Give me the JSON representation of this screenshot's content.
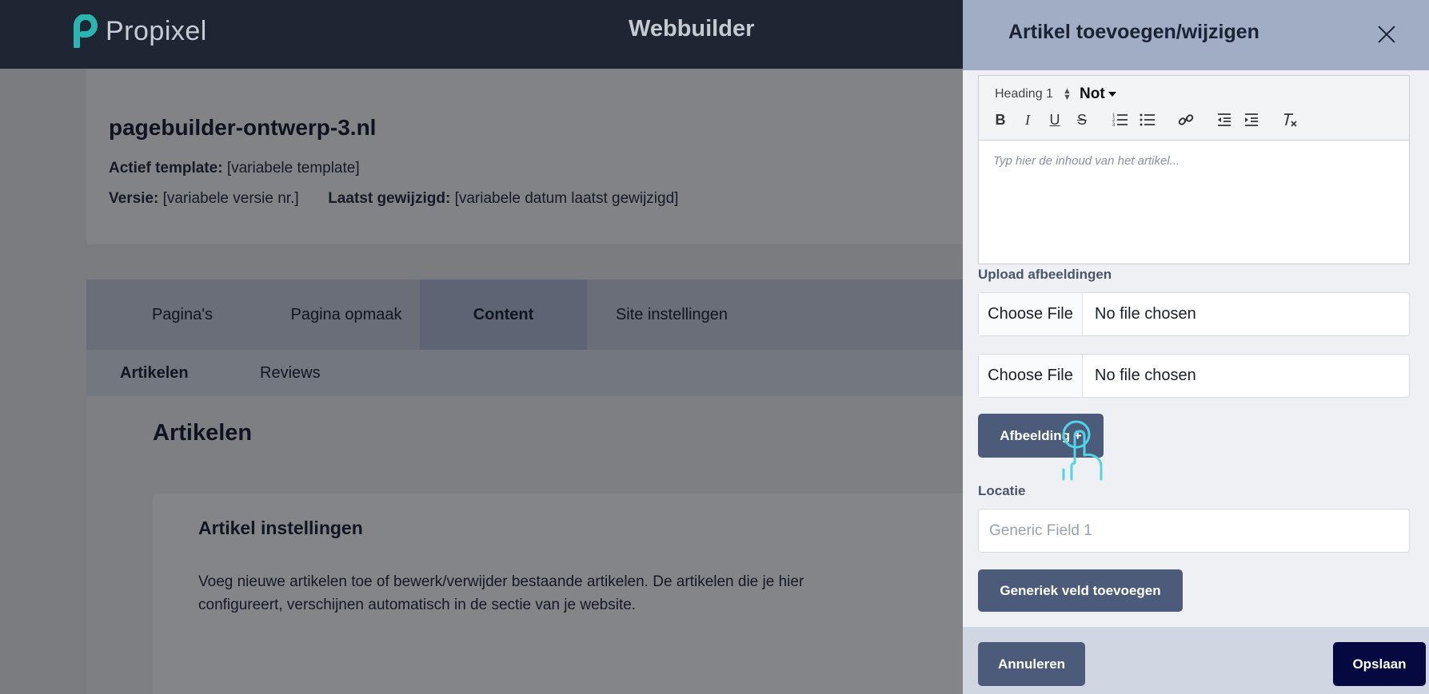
{
  "header": {
    "logo_text": "Propixel",
    "app_title": "Webbuilder"
  },
  "site": {
    "title": "pagebuilder-ontwerp-3.nl",
    "template_label": "Actief template:",
    "template_value": "[variabele template]",
    "version_label": "Versie:",
    "version_value": "[variabele versie nr.]",
    "modified_label": "Laatst gewijzigd:",
    "modified_value": "[variabele datum laatst gewijzigd]"
  },
  "tabs": [
    {
      "label": "Pagina's",
      "active": false
    },
    {
      "label": "Pagina opmaak",
      "active": false
    },
    {
      "label": "Content",
      "active": true
    },
    {
      "label": "Site instellingen",
      "active": false
    }
  ],
  "subtabs": [
    {
      "label": "Artikelen",
      "active": true
    },
    {
      "label": "Reviews",
      "active": false
    }
  ],
  "content": {
    "section_heading": "Artikelen",
    "settings_heading": "Artikel instellingen",
    "settings_text": "Voeg nieuwe artikelen toe of bewerk/verwijder bestaande artikelen. De artikelen die je hier configureert, verschijnen automatisch in de sectie van je website."
  },
  "panel": {
    "title": "Artikel toevoegen/wijzigen",
    "editor": {
      "heading_select": "Heading 1",
      "font_select": "Not",
      "placeholder": "Typ hier de inhoud van het artikel...",
      "toolbar_icons": [
        "bold-icon",
        "italic-icon",
        "underline-icon",
        "strikethrough-icon",
        "ordered-list-icon",
        "bullet-list-icon",
        "link-icon",
        "outdent-icon",
        "indent-icon",
        "clear-format-icon"
      ]
    },
    "upload_label": "Upload afbeeldingen",
    "file_inputs": [
      {
        "button": "Choose File",
        "status": "No file chosen"
      },
      {
        "button": "Choose File",
        "status": "No file chosen"
      }
    ],
    "add_image_button": "Afbeelding +",
    "location_label": "Locatie",
    "generic_field_placeholder": "Generic Field 1",
    "add_generic_button": "Generiek veld toevoegen",
    "cancel_button": "Annuleren",
    "save_button": "Opslaan"
  },
  "colors": {
    "header_bg": "#1e2533",
    "panel_header_bg": "#a1adc4",
    "button_bg": "#4d5b7b",
    "primary_button_bg": "#06093f",
    "logo_accent": "#2bb5b0",
    "cursor_color": "#4fd6e4"
  }
}
